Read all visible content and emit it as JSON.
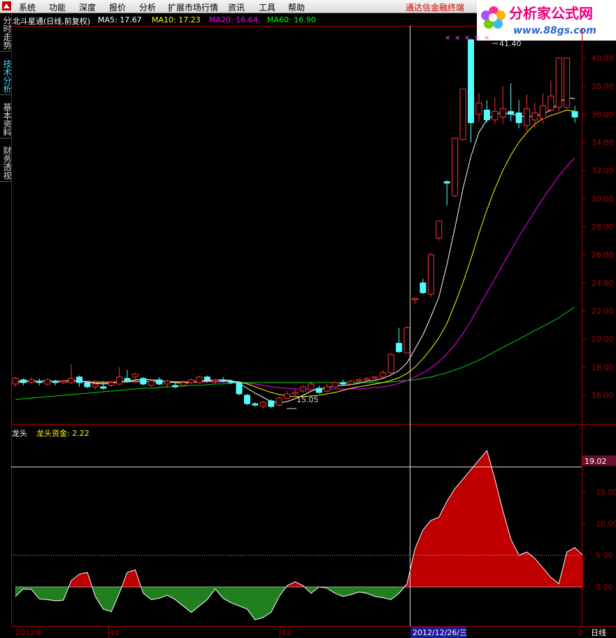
{
  "menu": {
    "items": [
      "系统",
      "功能",
      "深度",
      "报价",
      "分析",
      "扩展市场行情",
      "资讯",
      "工具",
      "帮助"
    ],
    "promo": "通达信金融终端"
  },
  "site_logo": {
    "text": "分析家公式网",
    "url_text": "www.88gs.com"
  },
  "side_tabs": [
    "分时走势",
    "技术分析",
    "基本资料",
    "财务透视"
  ],
  "main_chart": {
    "title": "北斗星通(日线,前复权)",
    "ma": [
      {
        "label": "MA5: 17.67",
        "color": "#ffffff"
      },
      {
        "label": "MA10: 17.23",
        "color": "#ffff00"
      },
      {
        "label": "MA20: 16.64",
        "color": "#ff00ff"
      },
      {
        "label": "MA60: 16.90",
        "color": "#00ff00"
      }
    ],
    "y_ticks": [
      "40.00",
      "38.00",
      "36.00",
      "34.00",
      "32.00",
      "30.00",
      "28.00",
      "26.00",
      "24.00",
      "22.00",
      "20.00",
      "18.00",
      "16.00"
    ],
    "high_label": "41.40",
    "low_label": "15.05"
  },
  "sub_chart": {
    "name": "龙头",
    "indicator": "龙头资金: 2.22",
    "y_ticks": [
      "15.00",
      "10.00",
      "5.00",
      "0.00"
    ],
    "current_label": "19.02"
  },
  "x_axis": {
    "labels": [
      "2012年",
      "11",
      "12",
      "2"
    ],
    "cursor_date": "2012/12/26/三",
    "period": "日线"
  },
  "colors": {
    "up": "#ff3232",
    "down": "#54fcfc",
    "area_pos": "#c00000",
    "area_neg": "#208020"
  },
  "chart_data": {
    "type": "candlestick",
    "ylim": [
      15,
      41.8
    ],
    "candles": [
      [
        16.8,
        17.2,
        17.3,
        16.6
      ],
      [
        17.1,
        16.9,
        17.2,
        16.7
      ],
      [
        16.9,
        17.1,
        17.3,
        16.8
      ],
      [
        17.0,
        16.9,
        17.2,
        16.7
      ],
      [
        16.8,
        17.1,
        17.2,
        16.7
      ],
      [
        17.0,
        16.9,
        17.1,
        16.7
      ],
      [
        16.9,
        17.0,
        17.1,
        16.8
      ],
      [
        16.9,
        17.2,
        18.2,
        16.8
      ],
      [
        17.3,
        16.9,
        17.4,
        16.6
      ],
      [
        16.9,
        16.6,
        17.0,
        16.5
      ],
      [
        16.6,
        16.8,
        16.9,
        16.4
      ],
      [
        16.6,
        16.5,
        17.0,
        16.4
      ],
      [
        16.7,
        16.9,
        17.0,
        16.6
      ],
      [
        16.8,
        17.3,
        18.0,
        16.7
      ],
      [
        17.2,
        17.0,
        17.8,
        16.9
      ],
      [
        17.3,
        17.5,
        17.6,
        17.0
      ],
      [
        17.2,
        16.8,
        17.3,
        16.7
      ],
      [
        16.7,
        17.0,
        17.1,
        16.6
      ],
      [
        17.1,
        16.8,
        17.3,
        16.7
      ],
      [
        16.8,
        17.0,
        17.1,
        16.5
      ],
      [
        16.7,
        16.6,
        16.9,
        16.5
      ],
      [
        16.7,
        16.9,
        17.0,
        16.6
      ],
      [
        16.9,
        17.1,
        17.2,
        16.8
      ],
      [
        16.9,
        17.3,
        17.4,
        16.8
      ],
      [
        17.3,
        17.1,
        17.4,
        16.9
      ],
      [
        17.0,
        17.1,
        17.2,
        16.8
      ],
      [
        17.1,
        17.0,
        17.3,
        16.9
      ],
      [
        17.0,
        16.9,
        17.1,
        16.8
      ],
      [
        16.9,
        16.1,
        17.0,
        16.0
      ],
      [
        16.0,
        15.4,
        16.1,
        15.3
      ],
      [
        15.4,
        15.3,
        15.5,
        15.2
      ],
      [
        15.2,
        15.5,
        15.6,
        15.05
      ],
      [
        15.6,
        15.2,
        15.7,
        15.1
      ],
      [
        15.3,
        15.8,
        15.9,
        15.2
      ],
      [
        15.8,
        16.1,
        16.3,
        15.7
      ],
      [
        16.1,
        16.2,
        16.4,
        15.9
      ],
      [
        16.3,
        16.6,
        16.7,
        16.2
      ],
      [
        16.4,
        16.8,
        17.0,
        16.3
      ],
      [
        16.5,
        16.2,
        16.7,
        16.1
      ],
      [
        16.3,
        16.6,
        16.8,
        16.2
      ],
      [
        16.6,
        16.9,
        17.0,
        16.5
      ],
      [
        16.9,
        16.8,
        17.1,
        16.7
      ],
      [
        16.8,
        17.0,
        17.1,
        16.7
      ],
      [
        17.0,
        17.1,
        17.2,
        16.9
      ],
      [
        17.1,
        17.2,
        17.3,
        17.0
      ],
      [
        17.2,
        17.3,
        17.4,
        17.1
      ],
      [
        17.3,
        17.6,
        17.8,
        17.2
      ],
      [
        17.6,
        18.9,
        19.0,
        17.5
      ],
      [
        19.7,
        19.1,
        20.8,
        19.0
      ],
      [
        19.0,
        20.8,
        20.9,
        19.0
      ],
      [
        22.8,
        22.9,
        22.9,
        22.5
      ],
      [
        24.0,
        23.3,
        24.3,
        23.2
      ],
      [
        23.2,
        26.0,
        26.1,
        23.0
      ],
      [
        27.2,
        28.4,
        28.4,
        27.0
      ],
      [
        31.2,
        31.1,
        31.3,
        29.5
      ],
      [
        30.2,
        34.3,
        34.3,
        30.1
      ],
      [
        34.2,
        37.8,
        37.8,
        34.1
      ],
      [
        41.3,
        35.4,
        41.4,
        34.0
      ],
      [
        36.0,
        36.8,
        37.5,
        35.5
      ],
      [
        36.3,
        35.6,
        37.0,
        35.4
      ],
      [
        35.6,
        36.2,
        37.2,
        35.3
      ],
      [
        35.8,
        36.4,
        38.0,
        35.3
      ],
      [
        36.2,
        36.0,
        38.2,
        35.5
      ],
      [
        36.1,
        35.4,
        37.0,
        35.0
      ],
      [
        35.2,
        36.4,
        37.4,
        34.8
      ],
      [
        35.6,
        36.1,
        36.8,
        35.0
      ],
      [
        35.7,
        36.6,
        37.5,
        35.3
      ],
      [
        36.3,
        37.3,
        38.4,
        36.2
      ],
      [
        36.5,
        40.0,
        40.0,
        36.2
      ],
      [
        36.5,
        40.0,
        40.0,
        36.4
      ],
      [
        36.2,
        35.8,
        36.6,
        35.4
      ]
    ],
    "ma5": [
      16.9,
      16.95,
      17.0,
      17.0,
      17.0,
      17.0,
      17.0,
      17.05,
      17.0,
      16.95,
      16.85,
      16.8,
      16.85,
      16.95,
      17.0,
      17.1,
      17.15,
      17.1,
      17.05,
      16.95,
      16.9,
      16.85,
      16.9,
      17.0,
      17.05,
      17.1,
      17.1,
      17.05,
      16.85,
      16.5,
      16.15,
      15.85,
      15.55,
      15.45,
      15.55,
      15.75,
      16.0,
      16.3,
      16.45,
      16.55,
      16.65,
      16.7,
      16.75,
      16.85,
      17.0,
      17.05,
      17.2,
      17.45,
      17.75,
      18.3,
      19.3,
      20.3,
      21.6,
      23.0,
      25.3,
      27.9,
      30.7,
      33.0,
      34.7,
      35.6,
      36.0,
      36.1,
      36.0,
      35.9,
      35.8,
      35.9,
      36.0,
      36.3,
      36.8,
      37.2,
      37.1
    ],
    "ma10": [
      17.0,
      17.0,
      17.0,
      17.0,
      17.0,
      17.0,
      17.0,
      17.0,
      17.0,
      16.95,
      16.9,
      16.9,
      16.9,
      16.95,
      16.95,
      17.0,
      17.0,
      17.0,
      17.0,
      17.0,
      16.95,
      16.95,
      16.95,
      17.0,
      17.0,
      17.0,
      17.0,
      17.0,
      16.95,
      16.8,
      16.6,
      16.4,
      16.2,
      16.05,
      15.95,
      15.9,
      15.9,
      15.95,
      16.0,
      16.1,
      16.2,
      16.35,
      16.5,
      16.6,
      16.7,
      16.8,
      16.9,
      17.05,
      17.25,
      17.55,
      18.0,
      18.6,
      19.3,
      20.1,
      21.1,
      22.5,
      24.0,
      25.7,
      27.5,
      29.2,
      30.7,
      32.0,
      33.1,
      34.0,
      34.7,
      35.3,
      35.7,
      35.9,
      36.1,
      36.3,
      36.2
    ],
    "ma20": [
      17.0,
      17.0,
      17.0,
      17.0,
      17.0,
      17.0,
      17.0,
      17.0,
      17.0,
      17.0,
      17.0,
      16.95,
      16.95,
      16.95,
      16.95,
      16.95,
      16.95,
      16.95,
      16.95,
      16.95,
      16.95,
      16.95,
      16.95,
      16.95,
      16.95,
      16.95,
      16.95,
      16.95,
      16.9,
      16.85,
      16.8,
      16.7,
      16.6,
      16.55,
      16.5,
      16.45,
      16.45,
      16.45,
      16.45,
      16.45,
      16.45,
      16.45,
      16.45,
      16.45,
      16.5,
      16.55,
      16.6,
      16.7,
      16.85,
      17.05,
      17.3,
      17.6,
      17.95,
      18.4,
      18.95,
      19.6,
      20.4,
      21.3,
      22.3,
      23.3,
      24.3,
      25.3,
      26.3,
      27.3,
      28.2,
      29.1,
      30.0,
      30.8,
      31.6,
      32.3,
      32.9
    ],
    "ma60": [
      15.7,
      15.75,
      15.8,
      15.85,
      15.9,
      15.95,
      16.0,
      16.05,
      16.1,
      16.15,
      16.2,
      16.25,
      16.3,
      16.35,
      16.4,
      16.45,
      16.5,
      16.5,
      16.55,
      16.6,
      16.6,
      16.65,
      16.7,
      16.7,
      16.75,
      16.8,
      16.8,
      16.85,
      16.9,
      16.9,
      16.9,
      16.9,
      16.9,
      16.9,
      16.9,
      16.9,
      16.9,
      16.9,
      16.9,
      16.9,
      16.9,
      16.9,
      16.9,
      16.9,
      16.9,
      16.9,
      16.9,
      16.95,
      17.0,
      17.05,
      17.1,
      17.2,
      17.3,
      17.45,
      17.6,
      17.8,
      18.0,
      18.25,
      18.5,
      18.8,
      19.1,
      19.4,
      19.7,
      20.0,
      20.3,
      20.6,
      20.9,
      21.2,
      21.5,
      21.9,
      22.3
    ],
    "longtou": [
      -1.5,
      -0.3,
      -0.4,
      -1.9,
      -2.0,
      -2.2,
      -2.1,
      1.0,
      2.0,
      2.3,
      -1.5,
      -3.5,
      -3.9,
      -1.0,
      2.3,
      2.7,
      -1.0,
      -2.0,
      -1.8,
      -1.3,
      -2.0,
      -3.0,
      -4.0,
      -3.0,
      -2.0,
      -0.3,
      -1.8,
      -2.5,
      -3.0,
      -3.5,
      -5.2,
      -4.8,
      -4.0,
      -1.5,
      0.2,
      0.8,
      0.2,
      -1.0,
      0.0,
      -0.2,
      -1.0,
      -1.5,
      -1.2,
      -0.8,
      -1.0,
      -1.5,
      -1.7,
      -2.0,
      -1.0,
      0.5,
      6.0,
      9.0,
      10.5,
      11.0,
      13.5,
      15.5,
      17.0,
      18.5,
      20.0,
      21.5,
      17.0,
      12.0,
      7.5,
      5.0,
      5.5,
      4.5,
      3.0,
      1.5,
      0.5,
      5.5,
      6.2,
      5.0
    ]
  }
}
